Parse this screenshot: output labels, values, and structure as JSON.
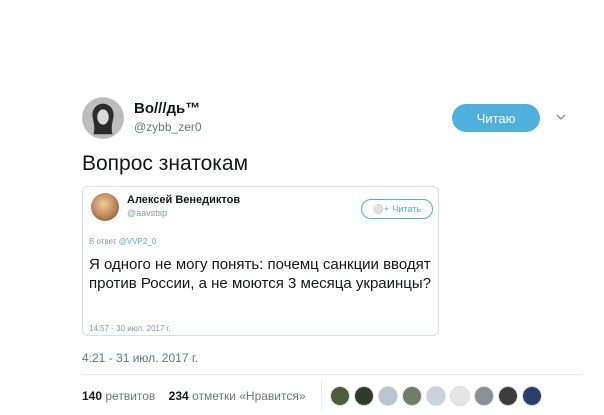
{
  "author": {
    "name": "Во///дь™",
    "handle": "@zybb_zer0",
    "follow_label": "Читаю"
  },
  "tweet": {
    "text": "Вопрос знатокам",
    "timestamp": "4:21 - 31 июл. 2017 г."
  },
  "quoted": {
    "name": "Алексей Венедиктов",
    "handle": "@aavstsp",
    "follow_label": "Читать",
    "reply_prefix": "В ответ",
    "reply_handle": "@VVP2_0",
    "text": "Я одного не могу понять: почемц санкции вводят против России, а не моются 3 месяца украинцы?",
    "time": "14:57 - 30 июл. 2017 г."
  },
  "stats": {
    "retweets_count": "140",
    "retweets_label": "ретвитов",
    "likes_count": "234",
    "likes_label": "отметки «Нравится»"
  },
  "likers": [
    {
      "color": "#4b5d3a"
    },
    {
      "color": "#2f3b2a"
    },
    {
      "color": "#b8c4cf"
    },
    {
      "color": "#6f7d6a"
    },
    {
      "color": "#c9d3dc"
    },
    {
      "color": "#e5e5e5"
    },
    {
      "color": "#8a8f94"
    },
    {
      "color": "#3c3c3c"
    },
    {
      "color": "#2a3f6b"
    }
  ]
}
